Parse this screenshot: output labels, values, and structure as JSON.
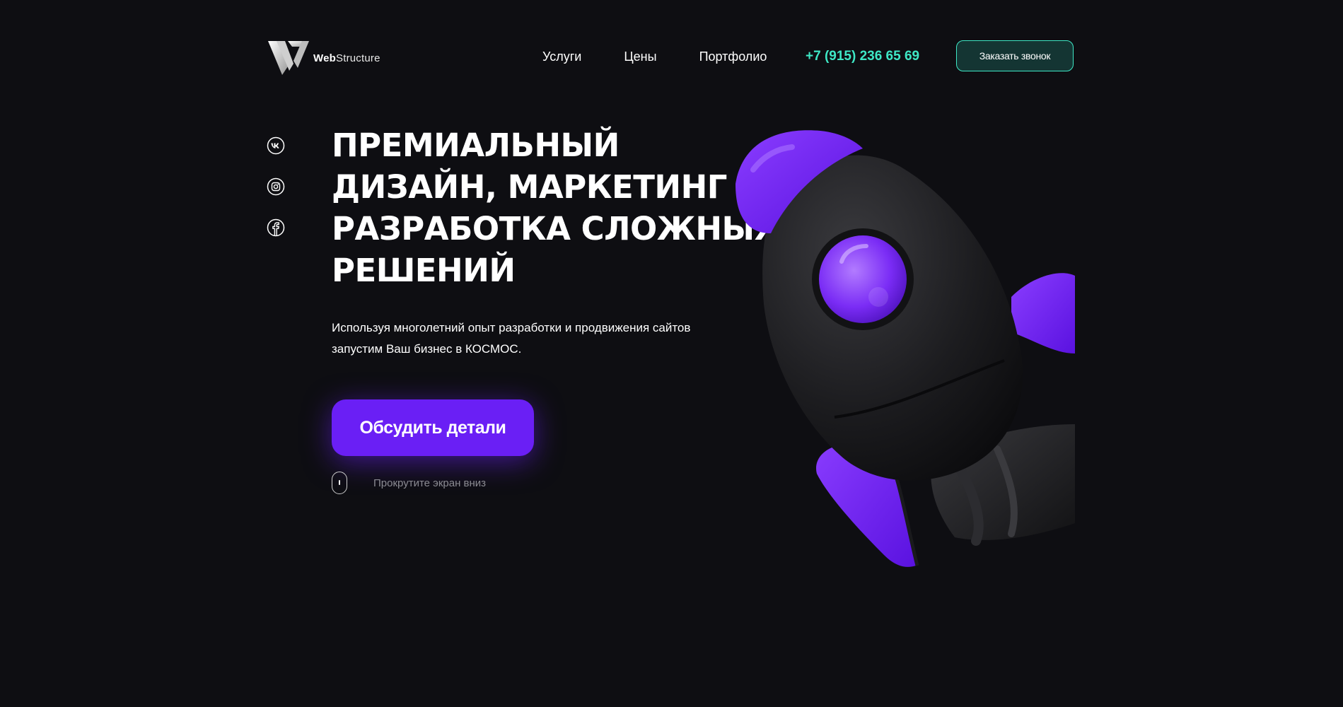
{
  "header": {
    "logo_bold": "Web",
    "logo_rest": "Structure",
    "nav": [
      {
        "label": "Услуги"
      },
      {
        "label": "Цены"
      },
      {
        "label": "Портфолио"
      }
    ],
    "phone": "+7 (915) 236 65 69",
    "call_button": "Заказать звонок"
  },
  "socials": [
    "vk-icon",
    "instagram-icon",
    "facebook-icon"
  ],
  "hero": {
    "title_lines": [
      "ПРЕМИАЛЬНЫЙ",
      "ДИЗАЙН, МАРКЕТИНГ И",
      "РАЗРАБОТКА СЛОЖНЫХ",
      "РЕШЕНИЙ"
    ],
    "subtitle_lines": [
      "Используя многолетний опыт разработки и продвижения сайтов",
      "запустим Ваш бизнес в КОСМОС."
    ],
    "cta": "Обсудить детали",
    "scroll_hint": "Прокрутите экран вниз"
  },
  "colors": {
    "background": "#0e0e12",
    "accent_purple": "#6a1ff5",
    "accent_teal": "#3ee7c5"
  }
}
